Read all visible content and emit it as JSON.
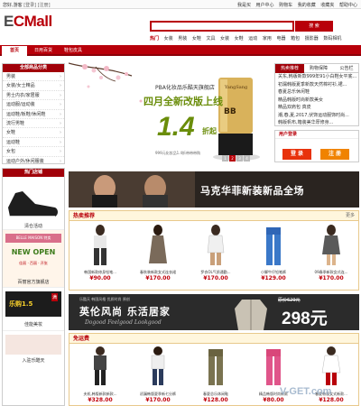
{
  "topbar": {
    "greeting": "您好,游客",
    "login": "[登录]",
    "register": "[注册]",
    "links": [
      "我是买",
      "用户中心",
      "购物车",
      "我的收藏",
      "收藏夹",
      "帮助中心"
    ]
  },
  "logo": {
    "text_e": "E",
    "text_rest": "CMall"
  },
  "search": {
    "button": "搜 索"
  },
  "hotwords": {
    "label": "热门",
    "items": [
      "女装",
      "男装",
      "女鞋",
      "文具",
      "女装",
      "女鞋",
      "运动",
      "家用",
      "电器",
      "箱包",
      "摄影器",
      "数码相机"
    ]
  },
  "nav": {
    "tabs": [
      "首页",
      "日用百货",
      "鞋包皮具"
    ]
  },
  "categories": {
    "title": "全部商品分类",
    "items": [
      "男装",
      "女装/女士精品",
      "男士内衣/家居服",
      "运动服/运动装",
      "运动鞋/板鞋/休闲鞋",
      "流行男鞋",
      "女鞋",
      "运动鞋",
      "女包",
      "运动户外/休闲服装"
    ]
  },
  "banner": {
    "title": "PBA化妆品乐酷天旗舰店",
    "headline": "四月全新改版上线",
    "discount": "1.4",
    "discount_unit": "折起",
    "sub": "999元化妆品1.4折带带带购",
    "pages": [
      "1",
      "2",
      "3",
      "4"
    ]
  },
  "news": {
    "tabs": [
      "热卖推荐",
      "购物保障",
      "公告栏"
    ],
    "items": [
      "关东,韩版新款999年91小白鞋女平底...",
      "初漏韩版夏季新款天然棉衬衫,裙...",
      "春夏总乐休闲鞋",
      "精品韩版时尚新款美女",
      "精品双肩包 真皮",
      "潮,春,夏,2017,伏饰运动服饰时尚...",
      "韩版帆布,箱装美华厚修身..."
    ]
  },
  "login": {
    "title": "用户登录",
    "login_button": "登 录",
    "register_button": "注 册"
  },
  "hotshop": {
    "title": "热门店铺",
    "shops": [
      "清仓活动",
      "百丽官方旗舰店",
      "佳能美妆",
      "入驻乐酷天"
    ],
    "promo1": "BELLE MAISON 特卖",
    "promo1_sub": "NEW OPEN",
    "promo1_cta": "佳丽 · 百丽 · 开张",
    "promo2_big": "乐购1.5",
    "promo2_small": "满"
  },
  "wide_banner": {
    "text": "马克华菲新装新品全场"
  },
  "section1": {
    "title": "热卖推荐",
    "products": [
      {
        "name": "韩国新款修身铅笔...",
        "price": "¥90.00"
      },
      {
        "name": "春秋装新款女式连衣裙",
        "price": "¥170.00"
      },
      {
        "name": "罗衣OL气质通勤...",
        "price": "¥170.00"
      },
      {
        "name": "小脚牛仔铅笔裤",
        "price": "¥129.00"
      },
      {
        "name": "09春季新款女式连...",
        "price": "¥170.00"
      }
    ]
  },
  "wide_banner2": {
    "line1": "乐酷天 韩国风格 优质时尚 原创",
    "big": "英伦风尚 乐活居家",
    "sub": "Dogood Feelgood Lookgood",
    "price_label": "原价629元",
    "price": "298元"
  },
  "section2": {
    "title": "免运费",
    "products": [
      {
        "name": "夫机,韩版新款新款...",
        "price": "¥328.00"
      },
      {
        "name": "初漏韩版夏季新七分裤",
        "price": "¥170.00"
      },
      {
        "name": "春夏总乐休闲鞋",
        "price": "¥128.00"
      },
      {
        "name": "精品韩版时尚新款",
        "price": "¥80.00"
      },
      {
        "name": "春夏韩版女式新款...",
        "price": "¥128.00"
      }
    ]
  },
  "more": "更多",
  "watermark": "V-GET.com",
  "colors": {
    "brand": "#b8000a",
    "accent_green": "#6a8d0a",
    "login": "#e8320c",
    "register": "#f08300"
  }
}
